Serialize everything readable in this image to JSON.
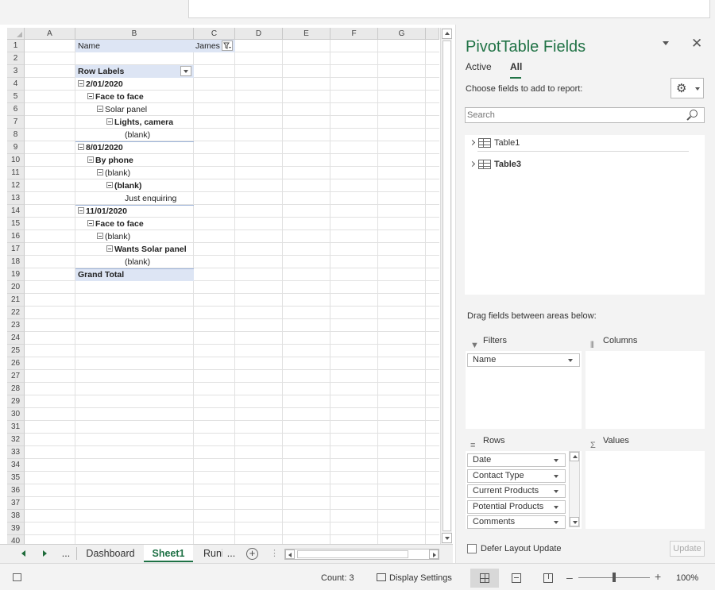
{
  "sheet": {
    "columns": [
      "A",
      "B",
      "C",
      "D",
      "E",
      "F",
      "G"
    ],
    "row_numbers": [
      "1",
      "2",
      "3",
      "4",
      "5",
      "6",
      "7",
      "8",
      "9",
      "10",
      "11",
      "12",
      "13",
      "14",
      "15",
      "16",
      "17",
      "18",
      "19",
      "20",
      "21",
      "22",
      "23",
      "24",
      "25",
      "26",
      "27",
      "28",
      "29",
      "30",
      "31",
      "32",
      "33",
      "34",
      "35",
      "36",
      "37",
      "38",
      "39",
      "40"
    ],
    "filter": {
      "label": "Name",
      "value": "James"
    },
    "row_labels_header": "Row Labels",
    "pivot_rows": [
      {
        "text": "2/01/2020",
        "level": 0,
        "bold": true,
        "expander": true
      },
      {
        "text": "Face to face",
        "level": 1,
        "bold": true,
        "expander": true
      },
      {
        "text": "Solar panel",
        "level": 2,
        "bold": false,
        "expander": true
      },
      {
        "text": "Lights, camera",
        "level": 3,
        "bold": true,
        "expander": true
      },
      {
        "text": "(blank)",
        "level": 4,
        "bold": false,
        "expander": false
      },
      {
        "text": "8/01/2020",
        "level": 0,
        "bold": true,
        "expander": true
      },
      {
        "text": "By phone",
        "level": 1,
        "bold": true,
        "expander": true
      },
      {
        "text": "(blank)",
        "level": 2,
        "bold": false,
        "expander": true
      },
      {
        "text": "(blank)",
        "level": 3,
        "bold": true,
        "expander": true
      },
      {
        "text": "Just enquiring",
        "level": 4,
        "bold": false,
        "expander": false
      },
      {
        "text": "11/01/2020",
        "level": 0,
        "bold": true,
        "expander": true
      },
      {
        "text": "Face to face",
        "level": 1,
        "bold": true,
        "expander": true
      },
      {
        "text": "(blank)",
        "level": 2,
        "bold": false,
        "expander": true
      },
      {
        "text": "Wants Solar panel",
        "level": 3,
        "bold": true,
        "expander": true
      },
      {
        "text": "(blank)",
        "level": 4,
        "bold": false,
        "expander": false
      }
    ],
    "grand_total": "Grand Total"
  },
  "sheet_tabs": {
    "more_left": "...",
    "tabs": [
      "Dashboard",
      "Sheet1",
      "Runi"
    ],
    "active": "Sheet1",
    "more_right": "...",
    "add_icon": "plus-circle-icon",
    "add_glyph": "+"
  },
  "pivot_panel": {
    "title": "PivotTable Fields",
    "close_glyph": "✕",
    "tabs": {
      "active": "Active",
      "all": "All"
    },
    "choose_label": "Choose fields to add to report:",
    "gear_glyph": "⚙",
    "search_placeholder": "Search",
    "fields": [
      "Table1",
      "Table3"
    ],
    "drag_label": "Drag fields between areas below:",
    "areas": {
      "filters": {
        "label": "Filters",
        "icon": "filter-icon",
        "glyph": "▼",
        "items": [
          "Name"
        ]
      },
      "columns": {
        "label": "Columns",
        "icon": "columns-icon",
        "glyph": "⦀",
        "items": []
      },
      "rows": {
        "label": "Rows",
        "icon": "rows-icon",
        "glyph": "≡",
        "items": [
          "Date",
          "Contact Type",
          "Current Products",
          "Potential Products",
          "Comments"
        ]
      },
      "values": {
        "label": "Values",
        "icon": "sigma-icon",
        "glyph": "Σ",
        "items": []
      }
    },
    "defer_label": "Defer Layout Update",
    "update_label": "Update"
  },
  "status_bar": {
    "count": "Count: 3",
    "display_settings": "Display Settings",
    "zoom_minus": "–",
    "zoom_plus": "+",
    "zoom": "100%",
    "zoom_percent": 100
  }
}
